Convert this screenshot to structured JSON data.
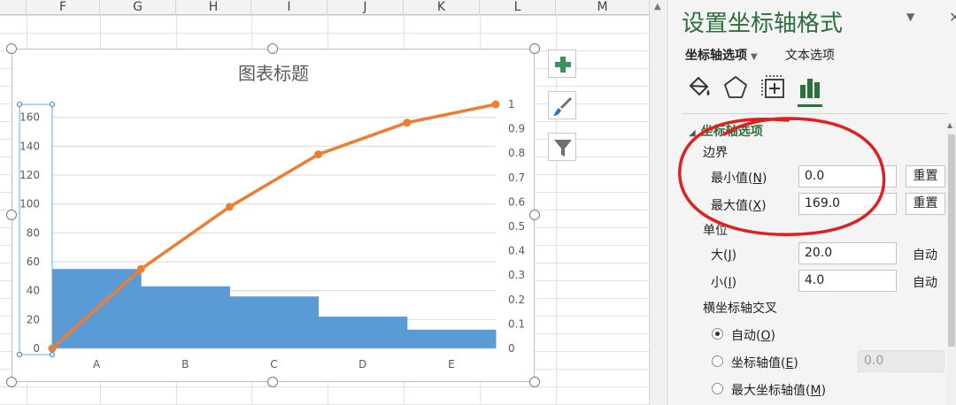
{
  "sheet": {
    "columns": [
      "F",
      "G",
      "H",
      "I",
      "J",
      "K",
      "L",
      "M"
    ]
  },
  "chart_data": {
    "type": "bar",
    "title": "图表标题",
    "categories": [
      "A",
      "B",
      "C",
      "D",
      "E"
    ],
    "series": [
      {
        "type": "bar",
        "axis": "primary",
        "values": [
          55,
          43,
          36,
          22,
          13
        ],
        "color": "#5b9bd5"
      },
      {
        "type": "line",
        "axis": "secondary",
        "x": [
          0,
          1,
          2,
          3,
          4,
          5
        ],
        "values": [
          0,
          0.325,
          0.58,
          0.795,
          0.925,
          1.0
        ],
        "color": "#ed7d31"
      }
    ],
    "y_primary": {
      "min": 0,
      "max": 169,
      "ticks": [
        "0",
        "20",
        "40",
        "60",
        "80",
        "100",
        "120",
        "140",
        "160"
      ]
    },
    "y_secondary": {
      "min": 0,
      "max": 1,
      "ticks": [
        "0",
        "0.1",
        "0.2",
        "0.3",
        "0.4",
        "0.5",
        "0.6",
        "0.7",
        "0.8",
        "0.9",
        "1"
      ]
    },
    "grid": true,
    "legend": "none"
  },
  "chart_tools": {
    "elements_icon": "plus-icon",
    "styles_icon": "brush-icon",
    "filters_icon": "filter-icon"
  },
  "pane": {
    "title": "设置坐标轴格式",
    "tabs": [
      {
        "label": "坐标轴选项",
        "active": true
      },
      {
        "label": "文本选项",
        "active": false
      }
    ],
    "category_icons": [
      "fill-bucket-icon",
      "pentagon-icon",
      "size-properties-icon",
      "bar-chart-icon"
    ],
    "section_title": "坐标轴选项",
    "bounds_label": "边界",
    "min": {
      "label": "最小值",
      "key": "N",
      "value": "0.0",
      "reset": "重置"
    },
    "max": {
      "label": "最大值",
      "key": "X",
      "value": "169.0",
      "reset": "重置"
    },
    "units_label": "单位",
    "major": {
      "label": "大",
      "key": "J",
      "value": "20.0",
      "auto": "自动"
    },
    "minor": {
      "label": "小",
      "key": "I",
      "value": "4.0",
      "auto": "自动"
    },
    "crosses_label": "横坐标轴交叉",
    "crosses_options": [
      {
        "label": "自动",
        "key": "O",
        "checked": true
      },
      {
        "label": "坐标轴值",
        "key": "E",
        "checked": false,
        "value": "0.0"
      },
      {
        "label": "最大坐标轴值",
        "key": "M",
        "checked": false
      }
    ]
  },
  "colors": {
    "accent_green": "#2e6e3f",
    "bar_blue": "#5b9bd5",
    "line_orange": "#ed7d31",
    "annotation_red": "#e02020"
  }
}
